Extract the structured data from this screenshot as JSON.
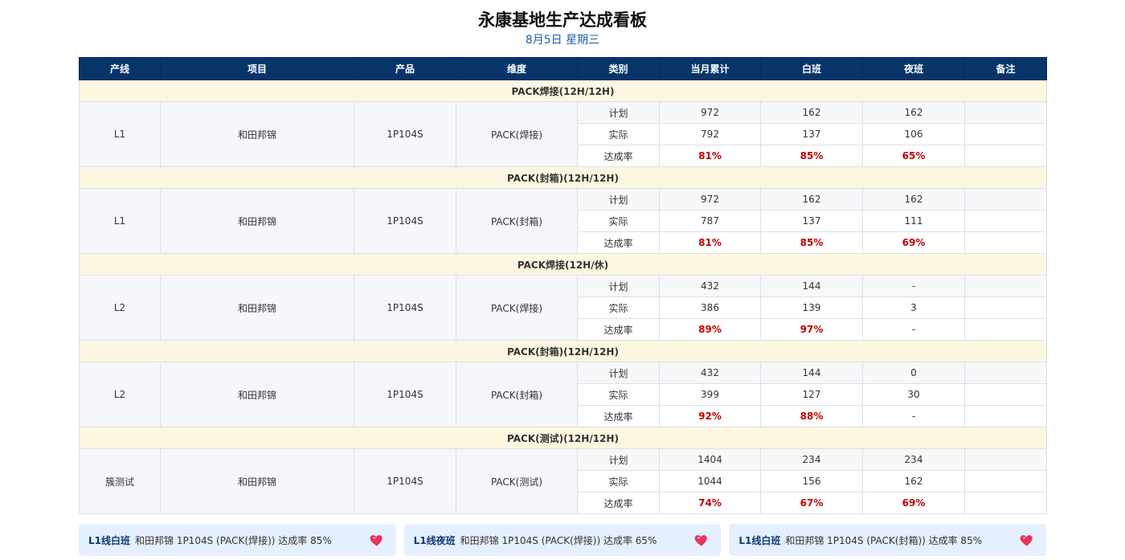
{
  "header": {
    "title": "永康基地生产达成看板",
    "date": "8月5日 星期三"
  },
  "columns": [
    "产线",
    "项目",
    "产品",
    "维度",
    "类别",
    "当月累计",
    "白班",
    "夜班",
    "备注"
  ],
  "sections": [
    {
      "title": "PACK焊接(12H/12H)",
      "line": "L1",
      "project": "和田邦锦",
      "product": "1P104S",
      "dimension": "PACK(焊接)",
      "rows": [
        {
          "category": "计划",
          "monthly": "972",
          "day": "162",
          "night": "162",
          "note": ""
        },
        {
          "category": "实际",
          "monthly": "792",
          "day": "137",
          "night": "106",
          "note": ""
        },
        {
          "category": "达成率",
          "monthly": "81%",
          "day": "85%",
          "night": "65%",
          "note": ""
        }
      ]
    },
    {
      "title": "PACK(封箱)(12H/12H)",
      "line": "L1",
      "project": "和田邦锦",
      "product": "1P104S",
      "dimension": "PACK(封箱)",
      "rows": [
        {
          "category": "计划",
          "monthly": "972",
          "day": "162",
          "night": "162",
          "note": ""
        },
        {
          "category": "实际",
          "monthly": "787",
          "day": "137",
          "night": "111",
          "note": ""
        },
        {
          "category": "达成率",
          "monthly": "81%",
          "day": "85%",
          "night": "69%",
          "note": ""
        }
      ]
    },
    {
      "title": "PACK焊接(12H/休)",
      "line": "L2",
      "project": "和田邦锦",
      "product": "1P104S",
      "dimension": "PACK(焊接)",
      "rows": [
        {
          "category": "计划",
          "monthly": "432",
          "day": "144",
          "night": "-",
          "note": ""
        },
        {
          "category": "实际",
          "monthly": "386",
          "day": "139",
          "night": "3",
          "note": ""
        },
        {
          "category": "达成率",
          "monthly": "89%",
          "day": "97%",
          "night": "-",
          "note": ""
        }
      ]
    },
    {
      "title": "PACK(封箱)(12H/12H)",
      "line": "L2",
      "project": "和田邦锦",
      "product": "1P104S",
      "dimension": "PACK(封箱)",
      "rows": [
        {
          "category": "计划",
          "monthly": "432",
          "day": "144",
          "night": "0",
          "note": ""
        },
        {
          "category": "实际",
          "monthly": "399",
          "day": "127",
          "night": "30",
          "note": ""
        },
        {
          "category": "达成率",
          "monthly": "92%",
          "day": "88%",
          "night": "-",
          "note": ""
        }
      ]
    },
    {
      "title": "PACK(测试)(12H/12H)",
      "line": "簇测试",
      "project": "和田邦锦",
      "product": "1P104S",
      "dimension": "PACK(测试)",
      "rows": [
        {
          "category": "计划",
          "monthly": "1404",
          "day": "234",
          "night": "234",
          "note": ""
        },
        {
          "category": "实际",
          "monthly": "1044",
          "day": "156",
          "night": "162",
          "note": ""
        },
        {
          "category": "达成率",
          "monthly": "74%",
          "day": "67%",
          "night": "69%",
          "note": ""
        }
      ]
    }
  ],
  "cards": [
    {
      "line": "L1线白班",
      "text": "和田邦锦 1P104S (PACK(焊接)) 达成率 85%",
      "icon": "heart-icon"
    },
    {
      "line": "L1线夜班",
      "text": "和田邦锦 1P104S (PACK(焊接)) 达成率 65%",
      "icon": "heart-icon"
    },
    {
      "line": "L1线白班",
      "text": "和田邦锦 1P104S (PACK(封箱)) 达成率 85%",
      "icon": "heart-icon"
    }
  ],
  "colors": {
    "header_bg": "#07356a",
    "section_bg": "#fdf7e1",
    "rate_text": "#c00000",
    "card_bg": "#e4efff",
    "heart": "#e8355a"
  }
}
